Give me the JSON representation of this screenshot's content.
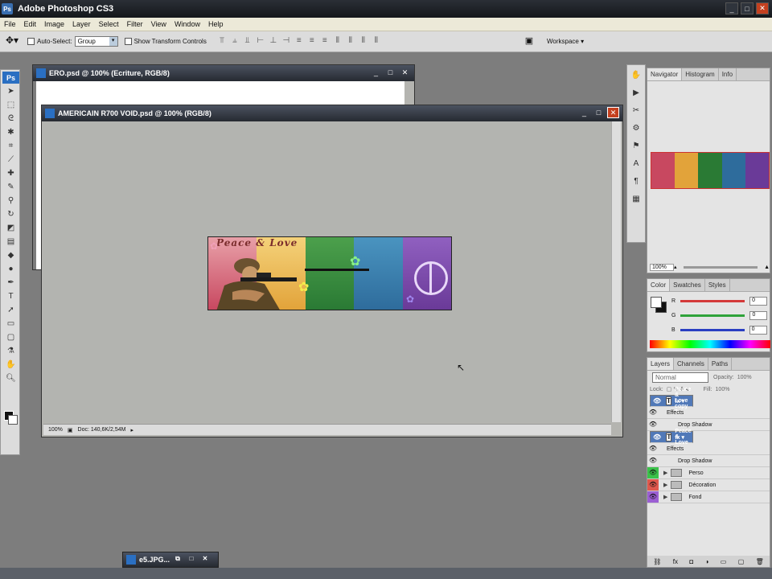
{
  "app": {
    "title": "Adobe Photoshop CS3",
    "logo": "Ps"
  },
  "window_buttons": {
    "minimize": "_",
    "maximize": "□",
    "close": "✕"
  },
  "menu": [
    "File",
    "Edit",
    "Image",
    "Layer",
    "Select",
    "Filter",
    "View",
    "Window",
    "Help"
  ],
  "options": {
    "auto_select_label": "Auto-Select:",
    "auto_select_value": "Group",
    "transform_label": "Show Transform Controls",
    "workspace_label": "Workspace ▾"
  },
  "doc1": {
    "title": "ERO.psd @ 100% (Ecriture, RGB/8)"
  },
  "doc2": {
    "title": "AMERICAIN R700 VOID.psd @ 100% (RGB/8)",
    "zoom": "100%",
    "doc_info": "Doc: 140,6K/2,54M"
  },
  "banner": {
    "title": "Peace & Love",
    "colors": [
      "#d45a6a",
      "#e6b13a",
      "#2f8b3a",
      "#3a86b4",
      "#7a48a8"
    ]
  },
  "navigator": {
    "tabs": [
      "Navigator",
      "Histogram",
      "Info"
    ],
    "zoom": "100%"
  },
  "color_panel": {
    "tabs": [
      "Color",
      "Swatches",
      "Styles"
    ],
    "channels": [
      {
        "label": "R",
        "value": "0",
        "color": "#d43a3a"
      },
      {
        "label": "G",
        "value": "0",
        "color": "#2fa33a"
      },
      {
        "label": "B",
        "value": "0",
        "color": "#2a3fc2"
      }
    ]
  },
  "layers_panel": {
    "tabs": [
      "Layers",
      "Channels",
      "Paths"
    ],
    "blend_mode": "Normal",
    "opacity_label": "Opacity:",
    "opacity_value": "100%",
    "lock_label": "Lock:",
    "fill_label": "Fill:",
    "fill_value": "100%",
    "rows": [
      {
        "name": "Peace & Love copy 2",
        "selected": true,
        "effects": [
          "Effects",
          "Drop Shadow"
        ]
      },
      {
        "name": "Peace & Love",
        "selected": true,
        "effects": [
          "Effects",
          "Drop Shadow"
        ]
      }
    ],
    "groups": [
      {
        "name": "Perso",
        "color": "green"
      },
      {
        "name": "Décoration",
        "color": "red"
      },
      {
        "name": "Fond",
        "color": "purple"
      }
    ]
  },
  "minidoc": {
    "title": "e5.JPG..."
  }
}
